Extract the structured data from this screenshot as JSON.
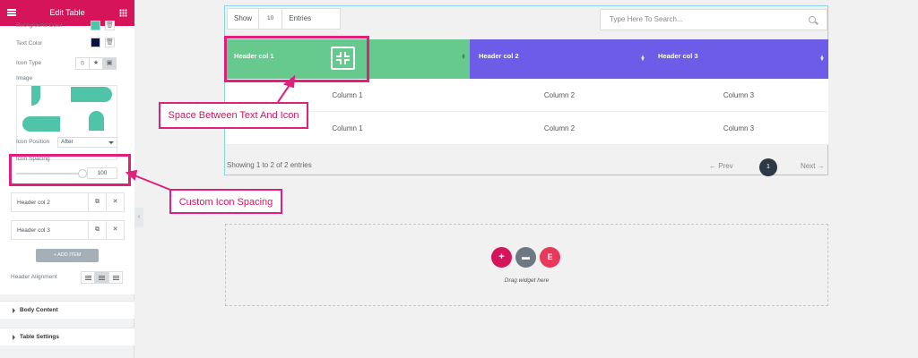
{
  "panel": {
    "title": "Edit Table",
    "controls": {
      "background_color_label": "Background Color",
      "background_color": "#4fc4a8",
      "text_color_label": "Text Color",
      "text_color": "#0b1340",
      "icon_type_label": "Icon Type",
      "icon_type_options": [
        "none-icon",
        "star-icon",
        "image-icon"
      ],
      "image_label": "Image",
      "icon_position_label": "Icon Position",
      "icon_position_value": "After",
      "icon_spacing_label": "Icon Spacing",
      "icon_spacing_value": "100"
    },
    "items": [
      {
        "label": "Header col 2"
      },
      {
        "label": "Header col 3"
      }
    ],
    "add_item_label": "+ ADD ITEM",
    "header_alignment_label": "Header Alignment",
    "sections": [
      {
        "label": "Body Content"
      },
      {
        "label": "Table Settings"
      }
    ]
  },
  "table": {
    "show_label": "Show",
    "entries_value": "10",
    "entries_label": "Entries",
    "search_placeholder": "Type Here To Search...",
    "headers": [
      {
        "label": "Header col 1",
        "color": "#66c98e"
      },
      {
        "label": "Header col 2",
        "color": "#6c5ce7"
      },
      {
        "label": "Header col 3",
        "color": "#6c5ce7"
      }
    ],
    "rows": [
      [
        "Column 1",
        "Column 2",
        "Column 3"
      ],
      [
        "Column 1",
        "Column 2",
        "Column 3"
      ]
    ],
    "info": "Showing 1 to 2 of 2 entries",
    "prev_label": "Prev",
    "page_number": "1",
    "next_label": "Next"
  },
  "drop_area": {
    "text": "Drag widget here"
  },
  "annotations": {
    "space_text_icon": "Space Between Text And Icon",
    "custom_icon_spacing": "Custom Icon Spacing",
    "color": "#e0207a"
  }
}
